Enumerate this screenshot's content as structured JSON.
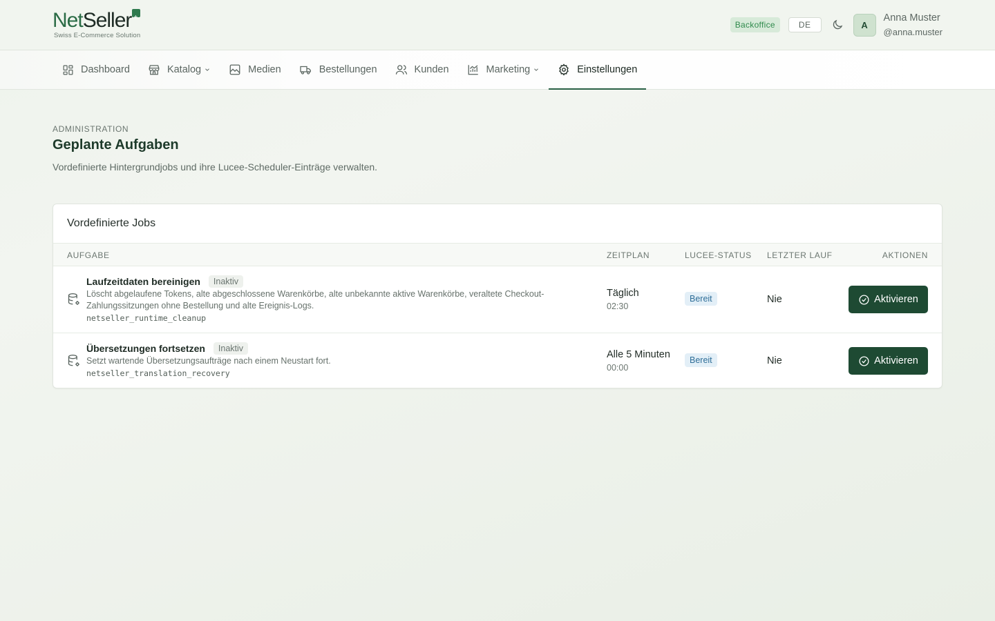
{
  "header": {
    "logo_net": "Net",
    "logo_seller": "Seller",
    "logo_tagline": "Swiss E-Commerce Solution",
    "badge": "Backoffice",
    "language": "DE",
    "theme_icon": "moon-icon",
    "avatar_initial": "A",
    "user_name": "Anna Muster",
    "user_handle": "@anna.muster"
  },
  "nav": {
    "items": [
      {
        "label": "Dashboard",
        "icon": "dashboard-icon",
        "has_dropdown": false,
        "active": false
      },
      {
        "label": "Katalog",
        "icon": "store-icon",
        "has_dropdown": true,
        "active": false
      },
      {
        "label": "Medien",
        "icon": "image-icon",
        "has_dropdown": false,
        "active": false
      },
      {
        "label": "Bestellungen",
        "icon": "truck-icon",
        "has_dropdown": false,
        "active": false
      },
      {
        "label": "Kunden",
        "icon": "users-icon",
        "has_dropdown": false,
        "active": false
      },
      {
        "label": "Marketing",
        "icon": "chart-icon",
        "has_dropdown": true,
        "active": false
      },
      {
        "label": "Einstellungen",
        "icon": "gear-icon",
        "has_dropdown": false,
        "active": true
      }
    ]
  },
  "page": {
    "eyebrow": "ADMINISTRATION",
    "title": "Geplante Aufgaben",
    "subtitle": "Vordefinierte Hintergrundjobs und ihre Lucee-Scheduler-Einträge verwalten."
  },
  "card": {
    "title": "Vordefinierte Jobs",
    "columns": {
      "task": "AUFGABE",
      "schedule": "ZEITPLAN",
      "status": "LUCEE-STATUS",
      "last_run": "LETZTER LAUF",
      "actions": "AKTIONEN"
    },
    "jobs": [
      {
        "title": "Laufzeitdaten bereinigen",
        "state": "Inaktiv",
        "description": "Löscht abgelaufene Tokens, alte abgeschlossene Warenkörbe, alte unbekannte aktive Warenkörbe, veraltete Checkout-Zahlungssitzungen ohne Bestellung und alte Ereignis-Logs.",
        "code": "netseller_runtime_cleanup",
        "schedule": "Täglich",
        "time": "02:30",
        "status": "Bereit",
        "last_run": "Nie",
        "action": "Aktivieren"
      },
      {
        "title": "Übersetzungen fortsetzen",
        "state": "Inaktiv",
        "description": "Setzt wartende Übersetzungsaufträge nach einem Neustart fort.",
        "code": "netseller_translation_recovery",
        "schedule": "Alle 5 Minuten",
        "time": "00:00",
        "status": "Bereit",
        "last_run": "Nie",
        "action": "Aktivieren"
      }
    ]
  },
  "colors": {
    "brand_dark": "#1e4a33",
    "status_ready_bg": "#e3eff7",
    "status_ready_text": "#2f6e98",
    "backoffice_badge": "#2f8a4c"
  }
}
